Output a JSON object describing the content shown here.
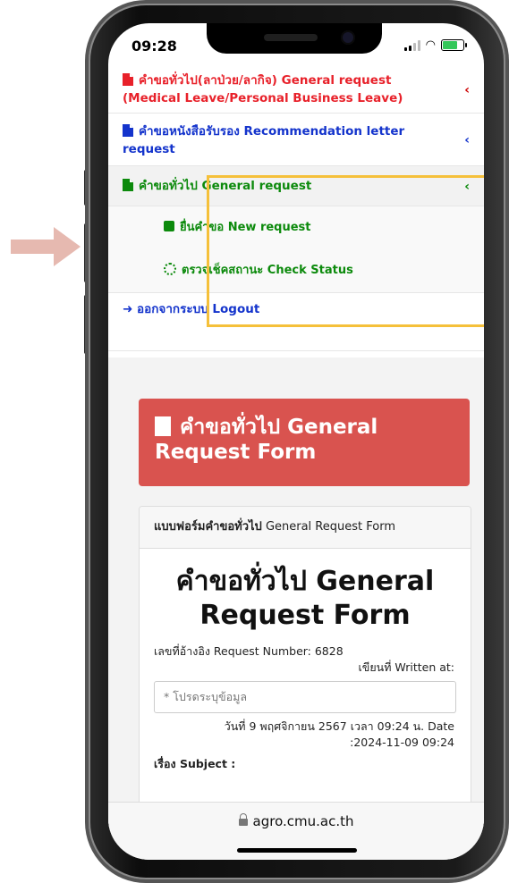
{
  "status": {
    "time": "09:28"
  },
  "menu": {
    "item_medical": "คำขอทั่วไป(ลาป่วย/ลากิจ) General request (Medical Leave/Personal Business Leave)",
    "item_recommendation": "คำขอหนังสือรับรอง Recommendation letter request",
    "item_general": "คำขอทั่วไป General request",
    "sub_new_request": "ยื่นคำขอ New request",
    "sub_check_status": "ตรวจเช็คสถานะ Check Status",
    "logout": "ออกจากระบบ Logout",
    "chevron": "‹"
  },
  "form": {
    "banner_title": "คำขอทั่วไป General Request Form",
    "card_header_bold": "แบบฟอร์มคำขอทั่วไป",
    "card_header_rest": "General Request Form",
    "title": "คำขอทั่วไป General Request Form",
    "request_number": "เลขที่อ้างอิง Request Number: 6828",
    "written_at": "เขียนที่ Written at:",
    "written_at_placeholder": "* โปรดระบุข้อมูล",
    "date_line1": "วันที่ 9 พฤศจิกายน 2567 เวลา 09:24 น. Date",
    "date_line2": ":2024-11-09 09:24",
    "subject_label": "เรื่อง Subject :"
  },
  "browser": {
    "address": "agro.cmu.ac.th"
  },
  "colors": {
    "accent_red": "#e8212a",
    "link_blue": "#1434cc",
    "active_green": "#0c8a0c",
    "banner": "#d9534f",
    "highlight": "#f5c03a"
  }
}
